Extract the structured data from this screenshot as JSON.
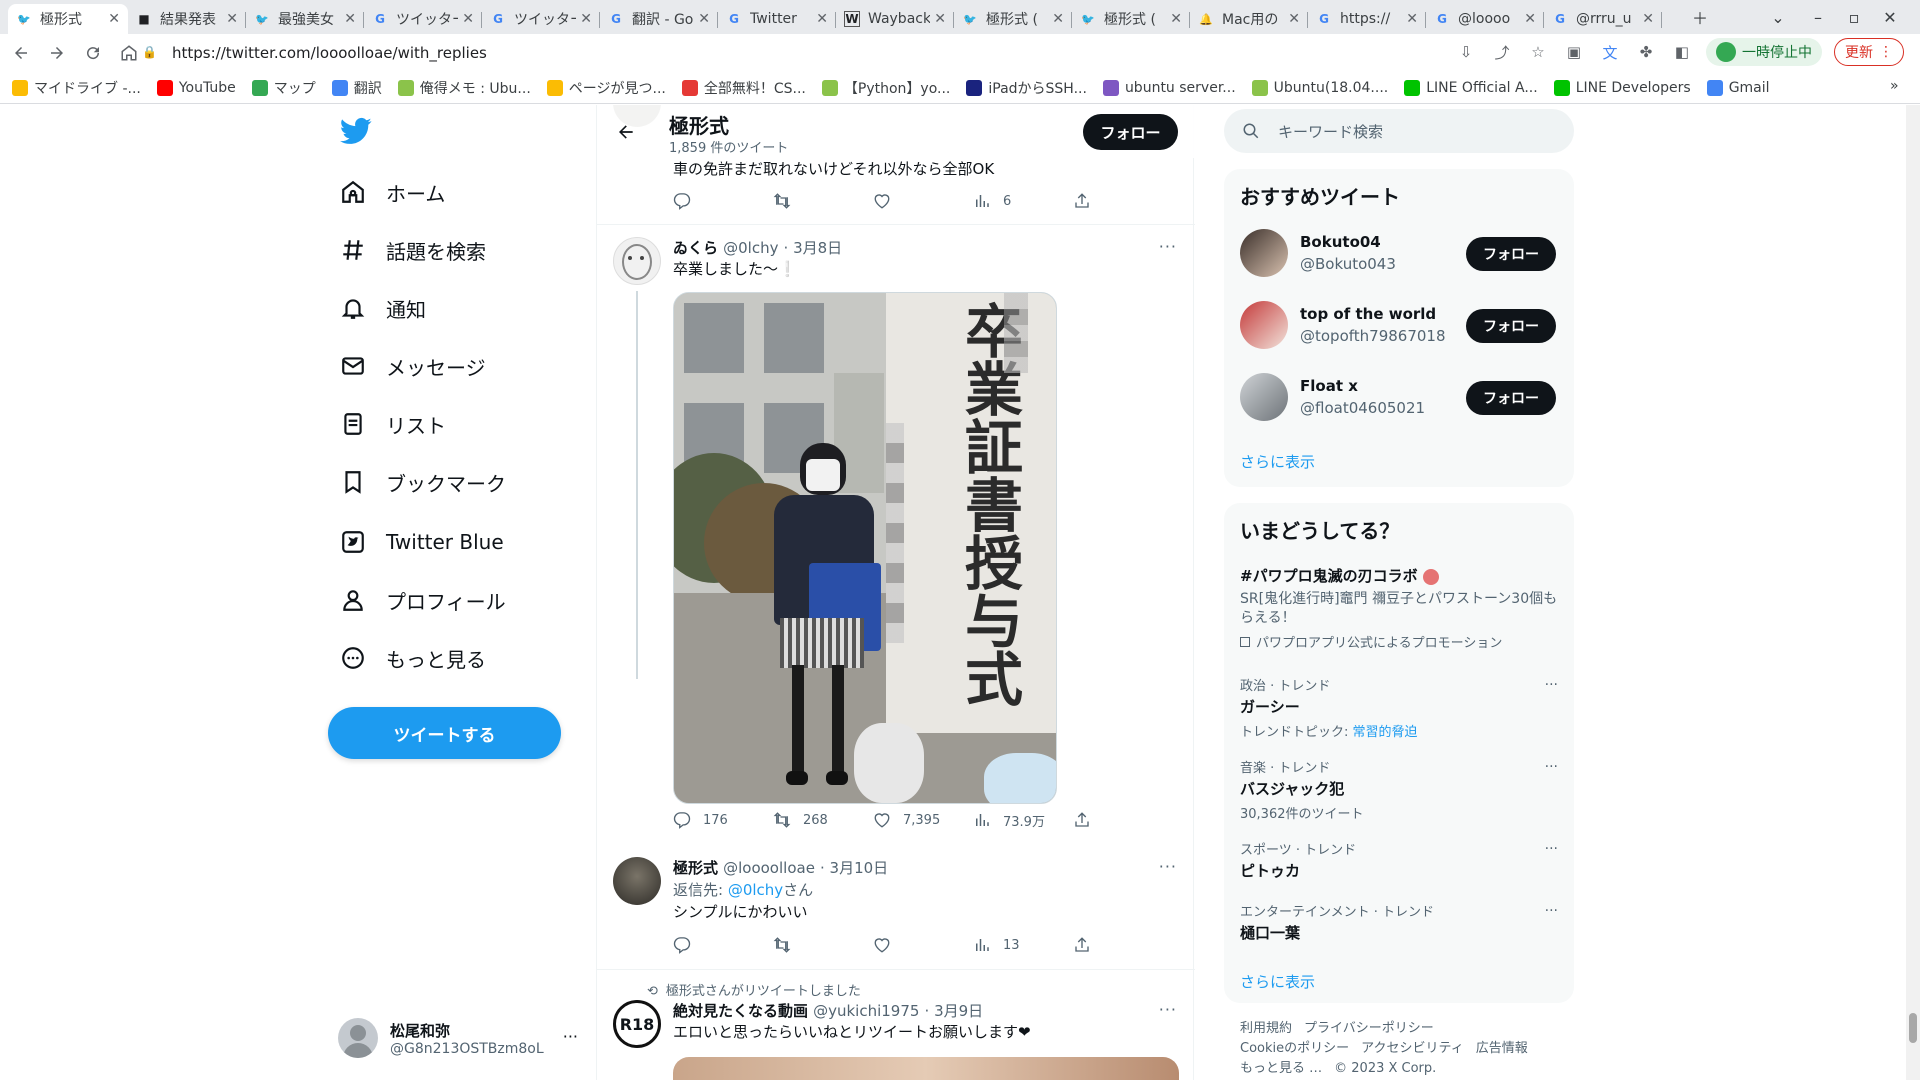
{
  "browser": {
    "tabs": [
      {
        "title": "極形式",
        "fav": "twitter",
        "color": "#1d9bf0"
      },
      {
        "title": "結果発表",
        "fav": "box",
        "color": "#202124"
      },
      {
        "title": "最強美女",
        "fav": "twitter",
        "color": "#1d9bf0"
      },
      {
        "title": "ツイッター",
        "fav": "G",
        "color": "#4285f4"
      },
      {
        "title": "ツイッター",
        "fav": "G",
        "color": "#4285f4"
      },
      {
        "title": "翻訳 - Go",
        "fav": "G",
        "color": "#4285f4"
      },
      {
        "title": "Twitter",
        "fav": "G",
        "color": "#4285f4"
      },
      {
        "title": "Wayback",
        "fav": "W",
        "color": "#202124"
      },
      {
        "title": "極形式 (",
        "fav": "twitter",
        "color": "#1d9bf0"
      },
      {
        "title": "極形式 (",
        "fav": "twitter",
        "color": "#1d9bf0"
      },
      {
        "title": "Mac用の",
        "fav": "bell",
        "color": "#4285f4"
      },
      {
        "title": "https://",
        "fav": "G",
        "color": "#4285f4"
      },
      {
        "title": "@loooo",
        "fav": "G",
        "color": "#4285f4"
      },
      {
        "title": "@rrru_u",
        "fav": "G",
        "color": "#4285f4"
      }
    ],
    "url": "https://twitter.com/loooolloae/with_replies",
    "paused_label": "一時停止中",
    "update_label": "更新",
    "bookmarks": [
      {
        "label": "マイドライブ -...",
        "color": "#fbbc04"
      },
      {
        "label": "YouTube",
        "color": "#ff0000"
      },
      {
        "label": "マップ",
        "color": "#34a853"
      },
      {
        "label": "翻訳",
        "color": "#4285f4"
      },
      {
        "label": "俺得メモ : Ubu...",
        "color": "#8bc34a"
      },
      {
        "label": "ページが見つ...",
        "color": "#fbbc04"
      },
      {
        "label": "全部無料！CS...",
        "color": "#e53935"
      },
      {
        "label": "【Python】yo...",
        "color": "#8bc34a"
      },
      {
        "label": "iPadからSSH...",
        "color": "#1a237e"
      },
      {
        "label": "ubuntu server...",
        "color": "#7e57c2"
      },
      {
        "label": "Ubuntu(18.04....",
        "color": "#8bc34a"
      },
      {
        "label": "LINE Official A...",
        "color": "#00c300"
      },
      {
        "label": "LINE Developers",
        "color": "#00c300"
      },
      {
        "label": "Gmail",
        "color": "#4285f4"
      }
    ]
  },
  "nav": {
    "items": [
      {
        "label": "ホーム",
        "icon": "home-icon"
      },
      {
        "label": "話題を検索",
        "icon": "hashtag-icon"
      },
      {
        "label": "通知",
        "icon": "bell-icon"
      },
      {
        "label": "メッセージ",
        "icon": "mail-icon"
      },
      {
        "label": "リスト",
        "icon": "list-icon"
      },
      {
        "label": "ブックマーク",
        "icon": "bookmark-icon"
      },
      {
        "label": "Twitter Blue",
        "icon": "twitter-blue-icon"
      },
      {
        "label": "プロフィール",
        "icon": "person-icon"
      },
      {
        "label": "もっと見る",
        "icon": "more-circle-icon"
      }
    ],
    "tweet_button": "ツイートする",
    "account": {
      "name": "松尾和弥",
      "handle": "@G8n213OSTBzm8oL"
    }
  },
  "profile": {
    "name": "極形式",
    "tweet_count": "1,859 件のツイート",
    "follow": "フォロー"
  },
  "timeline": {
    "partial": {
      "text": "車の免許まだ取れないけどそれ以外なら全部OK",
      "views": "6"
    },
    "t1": {
      "name": "ゐくら",
      "handle": "@0lchy",
      "date": "· 3月8日",
      "text": "卒業しました〜❕",
      "replies": "176",
      "retweets": "268",
      "likes": "7,395",
      "views": "73.9万",
      "banner_text": "卒業証書授与式"
    },
    "t2": {
      "name": "極形式",
      "handle": "@loooolloae",
      "date": "· 3月10日",
      "reply_prefix": "返信先: ",
      "reply_to": "@0lchy",
      "reply_suffix": "さん",
      "text": "シンプルにかわいい",
      "views": "13"
    },
    "t3": {
      "retweeted_by": "極形式さんがリツイートしました",
      "name": "絶対見たくなる動画",
      "handle": "@yukichi1975",
      "date": "· 3月9日",
      "text": "エロいと思ったらいいねとリツイートお願いします❤",
      "avatar_text": "R18"
    }
  },
  "sidebar": {
    "search_placeholder": "キーワード検索",
    "recommend_title": "おすすめツイート",
    "recommend": [
      {
        "name": "Bokuto04",
        "handle": "@Bokuto043"
      },
      {
        "name": "top of the world",
        "handle": "@topofth79867018"
      },
      {
        "name": "Float x",
        "handle": "@float04605021"
      }
    ],
    "follow": "フォロー",
    "show_more": "さらに表示",
    "trends_title": "いまどうしてる？",
    "promo": {
      "title": "#パワプロ鬼滅の刃コラボ",
      "desc": "SR[鬼化進行時]竈門 禰豆子とパワストーン30個もらえる！",
      "by": "パワプロアプリ公式によるプロモーション"
    },
    "trends": [
      {
        "category": "政治 · トレンド",
        "title": "ガーシー",
        "sub_prefix": "トレンドトピック: ",
        "sub_link": "常習的脅迫"
      },
      {
        "category": "音楽 · トレンド",
        "title": "バスジャック犯",
        "sub_prefix": "30,362件のツイート",
        "sub_link": ""
      },
      {
        "category": "スポーツ · トレンド",
        "title": "ピトゥカ",
        "sub_prefix": "",
        "sub_link": ""
      },
      {
        "category": "エンターテインメント · トレンド",
        "title": "樋口一葉",
        "sub_prefix": "",
        "sub_link": ""
      }
    ],
    "footer": {
      "terms": "利用規約",
      "privacy": "プライバシーポリシー",
      "cookie": "Cookieのポリシー",
      "accessibility": "アクセシビリティ",
      "ads": "広告情報",
      "more": "もっと見る …",
      "copyright": "© 2023 X Corp."
    }
  },
  "colors": {
    "accent": "#1d9bf0",
    "text": "#0f1419",
    "muted": "#536471",
    "panel": "#f7f9f9"
  }
}
